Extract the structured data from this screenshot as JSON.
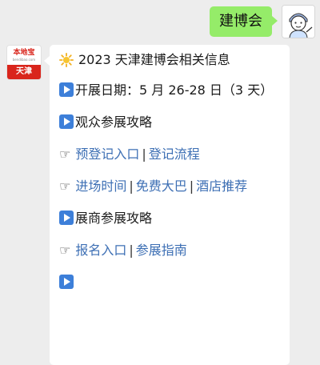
{
  "outgoing": {
    "text": "建博会"
  },
  "incoming": {
    "brand": {
      "name": "本地宝",
      "url": "bendibao.com",
      "city": "天津"
    },
    "title": "2023 天津建博会相关信息",
    "dates": "开展日期：5 月 26-28 日（3 天）",
    "visitor_heading": "观众参展攻略",
    "visitor_links_1": [
      "预登记入口",
      "登记流程"
    ],
    "visitor_links_2": [
      "进场时间",
      "免费大巴",
      "酒店推荐"
    ],
    "exhibitor_heading": "展商参展攻略",
    "exhibitor_links": [
      "报名入口",
      "参展指南"
    ],
    "separator": "|"
  },
  "colors": {
    "outgoing_bubble": "#95ec69",
    "link": "#3d6fb4",
    "brand_red": "#d9251c",
    "play_icon": "#3d7fd9"
  },
  "icons": {
    "title": "sun-icon",
    "section": "play-icon",
    "link_prefix": "pointing-hand-icon"
  }
}
